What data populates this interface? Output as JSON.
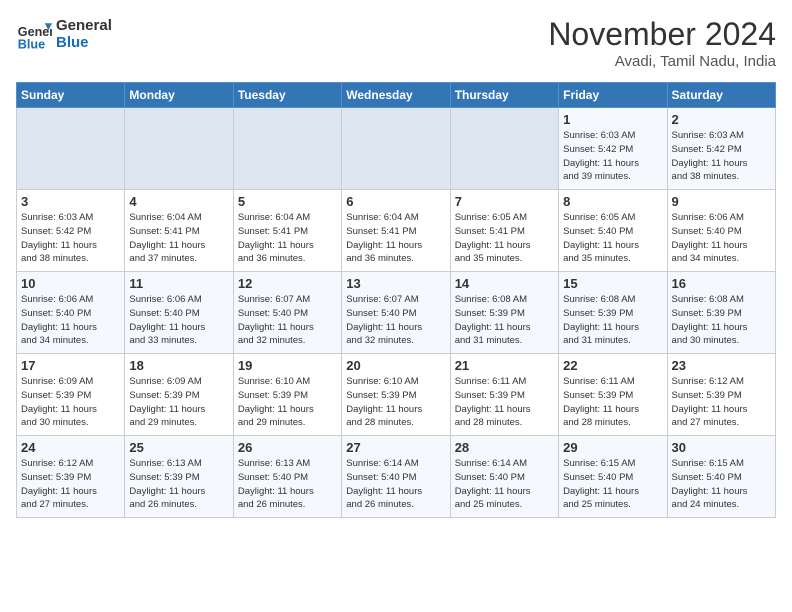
{
  "header": {
    "logo_line1": "General",
    "logo_line2": "Blue",
    "month": "November 2024",
    "location": "Avadi, Tamil Nadu, India"
  },
  "weekdays": [
    "Sunday",
    "Monday",
    "Tuesday",
    "Wednesday",
    "Thursday",
    "Friday",
    "Saturday"
  ],
  "weeks": [
    [
      {
        "day": "",
        "info": ""
      },
      {
        "day": "",
        "info": ""
      },
      {
        "day": "",
        "info": ""
      },
      {
        "day": "",
        "info": ""
      },
      {
        "day": "",
        "info": ""
      },
      {
        "day": "1",
        "info": "Sunrise: 6:03 AM\nSunset: 5:42 PM\nDaylight: 11 hours\nand 39 minutes."
      },
      {
        "day": "2",
        "info": "Sunrise: 6:03 AM\nSunset: 5:42 PM\nDaylight: 11 hours\nand 38 minutes."
      }
    ],
    [
      {
        "day": "3",
        "info": "Sunrise: 6:03 AM\nSunset: 5:42 PM\nDaylight: 11 hours\nand 38 minutes."
      },
      {
        "day": "4",
        "info": "Sunrise: 6:04 AM\nSunset: 5:41 PM\nDaylight: 11 hours\nand 37 minutes."
      },
      {
        "day": "5",
        "info": "Sunrise: 6:04 AM\nSunset: 5:41 PM\nDaylight: 11 hours\nand 36 minutes."
      },
      {
        "day": "6",
        "info": "Sunrise: 6:04 AM\nSunset: 5:41 PM\nDaylight: 11 hours\nand 36 minutes."
      },
      {
        "day": "7",
        "info": "Sunrise: 6:05 AM\nSunset: 5:41 PM\nDaylight: 11 hours\nand 35 minutes."
      },
      {
        "day": "8",
        "info": "Sunrise: 6:05 AM\nSunset: 5:40 PM\nDaylight: 11 hours\nand 35 minutes."
      },
      {
        "day": "9",
        "info": "Sunrise: 6:06 AM\nSunset: 5:40 PM\nDaylight: 11 hours\nand 34 minutes."
      }
    ],
    [
      {
        "day": "10",
        "info": "Sunrise: 6:06 AM\nSunset: 5:40 PM\nDaylight: 11 hours\nand 34 minutes."
      },
      {
        "day": "11",
        "info": "Sunrise: 6:06 AM\nSunset: 5:40 PM\nDaylight: 11 hours\nand 33 minutes."
      },
      {
        "day": "12",
        "info": "Sunrise: 6:07 AM\nSunset: 5:40 PM\nDaylight: 11 hours\nand 32 minutes."
      },
      {
        "day": "13",
        "info": "Sunrise: 6:07 AM\nSunset: 5:40 PM\nDaylight: 11 hours\nand 32 minutes."
      },
      {
        "day": "14",
        "info": "Sunrise: 6:08 AM\nSunset: 5:39 PM\nDaylight: 11 hours\nand 31 minutes."
      },
      {
        "day": "15",
        "info": "Sunrise: 6:08 AM\nSunset: 5:39 PM\nDaylight: 11 hours\nand 31 minutes."
      },
      {
        "day": "16",
        "info": "Sunrise: 6:08 AM\nSunset: 5:39 PM\nDaylight: 11 hours\nand 30 minutes."
      }
    ],
    [
      {
        "day": "17",
        "info": "Sunrise: 6:09 AM\nSunset: 5:39 PM\nDaylight: 11 hours\nand 30 minutes."
      },
      {
        "day": "18",
        "info": "Sunrise: 6:09 AM\nSunset: 5:39 PM\nDaylight: 11 hours\nand 29 minutes."
      },
      {
        "day": "19",
        "info": "Sunrise: 6:10 AM\nSunset: 5:39 PM\nDaylight: 11 hours\nand 29 minutes."
      },
      {
        "day": "20",
        "info": "Sunrise: 6:10 AM\nSunset: 5:39 PM\nDaylight: 11 hours\nand 28 minutes."
      },
      {
        "day": "21",
        "info": "Sunrise: 6:11 AM\nSunset: 5:39 PM\nDaylight: 11 hours\nand 28 minutes."
      },
      {
        "day": "22",
        "info": "Sunrise: 6:11 AM\nSunset: 5:39 PM\nDaylight: 11 hours\nand 28 minutes."
      },
      {
        "day": "23",
        "info": "Sunrise: 6:12 AM\nSunset: 5:39 PM\nDaylight: 11 hours\nand 27 minutes."
      }
    ],
    [
      {
        "day": "24",
        "info": "Sunrise: 6:12 AM\nSunset: 5:39 PM\nDaylight: 11 hours\nand 27 minutes."
      },
      {
        "day": "25",
        "info": "Sunrise: 6:13 AM\nSunset: 5:39 PM\nDaylight: 11 hours\nand 26 minutes."
      },
      {
        "day": "26",
        "info": "Sunrise: 6:13 AM\nSunset: 5:40 PM\nDaylight: 11 hours\nand 26 minutes."
      },
      {
        "day": "27",
        "info": "Sunrise: 6:14 AM\nSunset: 5:40 PM\nDaylight: 11 hours\nand 26 minutes."
      },
      {
        "day": "28",
        "info": "Sunrise: 6:14 AM\nSunset: 5:40 PM\nDaylight: 11 hours\nand 25 minutes."
      },
      {
        "day": "29",
        "info": "Sunrise: 6:15 AM\nSunset: 5:40 PM\nDaylight: 11 hours\nand 25 minutes."
      },
      {
        "day": "30",
        "info": "Sunrise: 6:15 AM\nSunset: 5:40 PM\nDaylight: 11 hours\nand 24 minutes."
      }
    ]
  ]
}
